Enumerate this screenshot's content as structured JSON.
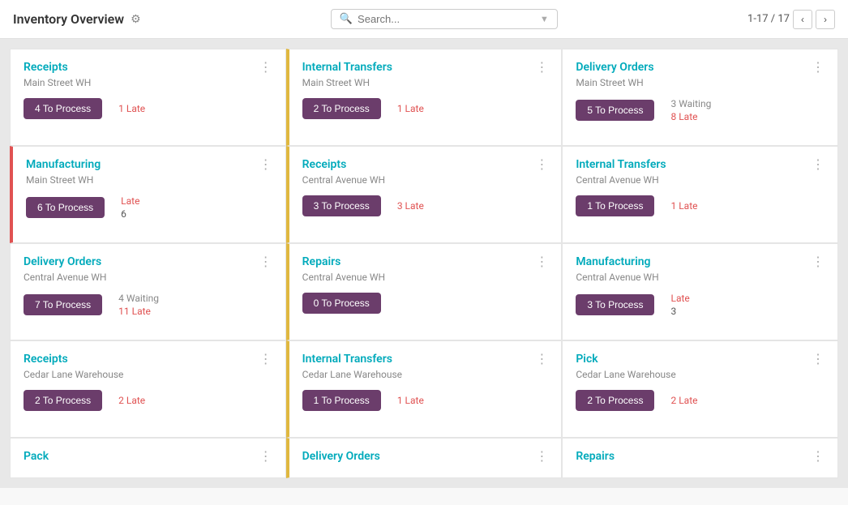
{
  "header": {
    "title": "Inventory Overview",
    "gear_icon": "⚙",
    "search_placeholder": "Search...",
    "pagination_label": "1-17 / 17"
  },
  "cards": [
    {
      "id": "receipts-main",
      "title": "Receipts",
      "subtitle": "Main Street WH",
      "button_label": "4 To Process",
      "stats": [
        {
          "label": "1 Late",
          "type": "late"
        }
      ],
      "border": "none"
    },
    {
      "id": "internal-transfers-main",
      "title": "Internal Transfers",
      "subtitle": "Main Street WH",
      "button_label": "2 To Process",
      "stats": [
        {
          "label": "1 Late",
          "type": "late"
        }
      ],
      "border": "yellow"
    },
    {
      "id": "delivery-orders-main",
      "title": "Delivery Orders",
      "subtitle": "Main Street WH",
      "button_label": "5 To Process",
      "stats": [
        {
          "label": "3 Waiting",
          "type": "waiting"
        },
        {
          "label": "8 Late",
          "type": "late"
        }
      ],
      "border": "none"
    },
    {
      "id": "manufacturing-main",
      "title": "Manufacturing",
      "subtitle": "Main Street WH",
      "button_label": "6 To Process",
      "stats": [
        {
          "label": "Late",
          "type": "late"
        },
        {
          "label": "6",
          "type": "number"
        }
      ],
      "border": "red"
    },
    {
      "id": "receipts-central",
      "title": "Receipts",
      "subtitle": "Central Avenue WH",
      "button_label": "3 To Process",
      "stats": [
        {
          "label": "3 Late",
          "type": "late"
        }
      ],
      "border": "yellow"
    },
    {
      "id": "internal-transfers-central",
      "title": "Internal Transfers",
      "subtitle": "Central Avenue WH",
      "button_label": "1 To Process",
      "stats": [
        {
          "label": "1 Late",
          "type": "late"
        }
      ],
      "border": "none"
    },
    {
      "id": "delivery-orders-central",
      "title": "Delivery Orders",
      "subtitle": "Central Avenue WH",
      "button_label": "7 To Process",
      "stats": [
        {
          "label": "4 Waiting",
          "type": "waiting"
        },
        {
          "label": "11 Late",
          "type": "late"
        }
      ],
      "border": "none"
    },
    {
      "id": "repairs-central",
      "title": "Repairs",
      "subtitle": "Central Avenue WH",
      "button_label": "0 To Process",
      "stats": [],
      "border": "yellow"
    },
    {
      "id": "manufacturing-central",
      "title": "Manufacturing",
      "subtitle": "Central Avenue WH",
      "button_label": "3 To Process",
      "stats": [
        {
          "label": "Late",
          "type": "late"
        },
        {
          "label": "3",
          "type": "number"
        }
      ],
      "border": "none"
    },
    {
      "id": "receipts-cedar",
      "title": "Receipts",
      "subtitle": "Cedar Lane Warehouse",
      "button_label": "2 To Process",
      "stats": [
        {
          "label": "2 Late",
          "type": "late"
        }
      ],
      "border": "none"
    },
    {
      "id": "internal-transfers-cedar",
      "title": "Internal Transfers",
      "subtitle": "Cedar Lane Warehouse",
      "button_label": "1 To Process",
      "stats": [
        {
          "label": "1 Late",
          "type": "late"
        }
      ],
      "border": "yellow"
    },
    {
      "id": "pick-cedar",
      "title": "Pick",
      "subtitle": "Cedar Lane Warehouse",
      "button_label": "2 To Process",
      "stats": [
        {
          "label": "2 Late",
          "type": "late"
        }
      ],
      "border": "none"
    },
    {
      "id": "pack-cedar",
      "title": "Pack",
      "subtitle": "",
      "button_label": "",
      "stats": [],
      "border": "none",
      "partial": true
    },
    {
      "id": "delivery-orders-bottom",
      "title": "Delivery Orders",
      "subtitle": "",
      "button_label": "",
      "stats": [],
      "border": "yellow",
      "partial": true
    },
    {
      "id": "repairs-bottom",
      "title": "Repairs",
      "subtitle": "",
      "button_label": "",
      "stats": [],
      "border": "none",
      "partial": true
    }
  ]
}
